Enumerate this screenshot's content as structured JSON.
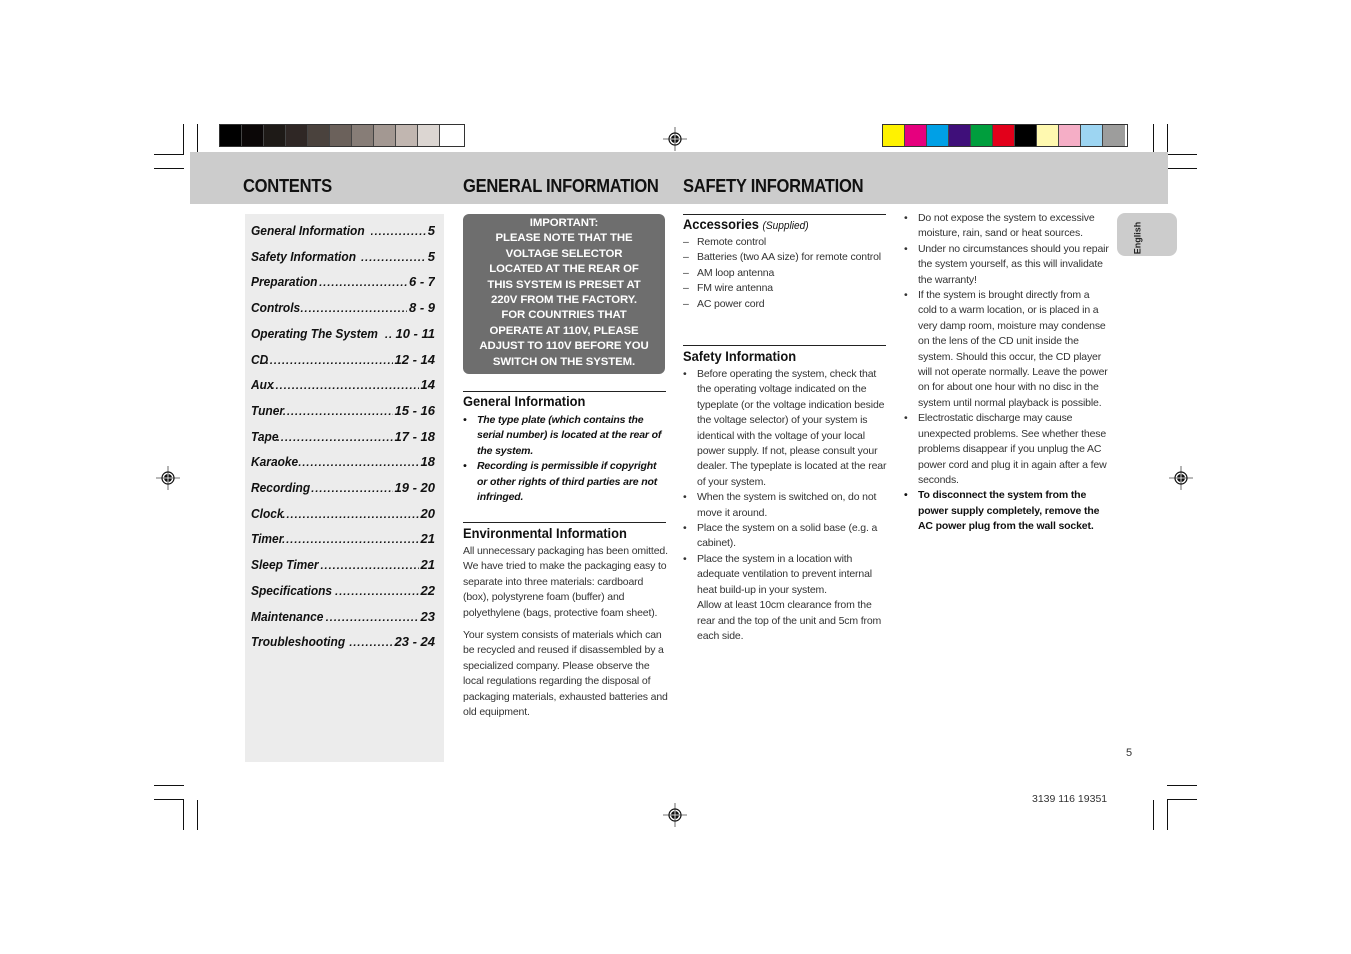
{
  "header": {
    "contents_title": "CONTENTS",
    "general_title": "GENERAL INFORMATION",
    "safety_title": "SAFETY INFORMATION"
  },
  "colorbars": {
    "grayscale": [
      "#000000",
      "#0b0707",
      "#1e1a17",
      "#2f2725",
      "#4a423d",
      "#6b615b",
      "#877d77",
      "#a39892",
      "#c1b6b0",
      "#dcd6d2",
      "#ffffff"
    ],
    "process": [
      "#fff200",
      "#e6007e",
      "#00a0e6",
      "#3f0f7a",
      "#009e3d",
      "#e2001a",
      "#000000",
      "#fff9b0",
      "#f5aec6",
      "#9dd5f2",
      "#9d9d9c"
    ]
  },
  "contents": [
    {
      "label": "General Information",
      "page": "5"
    },
    {
      "label": "Safety Information",
      "page": "5"
    },
    {
      "label": "Preparation",
      "page": "6 - 7"
    },
    {
      "label": "Controls",
      "page": "8 - 9"
    },
    {
      "label": "Operating The System",
      "page": "10 - 11"
    },
    {
      "label": "CD",
      "page": "12 - 14"
    },
    {
      "label": "Aux",
      "page": "14"
    },
    {
      "label": "Tuner",
      "page": "15 - 16"
    },
    {
      "label": "Tape",
      "page": "17 - 18"
    },
    {
      "label": "Karaoke",
      "page": "18"
    },
    {
      "label": "Recording",
      "page": "19 - 20"
    },
    {
      "label": "Clock",
      "page": "20"
    },
    {
      "label": "Timer",
      "page": "21"
    },
    {
      "label": "Sleep Timer",
      "page": "21"
    },
    {
      "label": "Specifications",
      "page": "22"
    },
    {
      "label": "Maintenance",
      "page": "23"
    },
    {
      "label": "Troubleshooting",
      "page": "23 - 24"
    }
  ],
  "important": {
    "lines": [
      "IMPORTANT:",
      "PLEASE NOTE THAT THE",
      "VOLTAGE SELECTOR",
      "LOCATED AT THE REAR OF",
      "THIS SYSTEM IS PRESET AT",
      "220V FROM THE FACTORY.",
      "FOR COUNTRIES THAT",
      "OPERATE AT 110V, PLEASE",
      "ADJUST TO 110V BEFORE YOU",
      "SWITCH ON THE SYSTEM."
    ]
  },
  "general_info": {
    "heading": "General Information",
    "bullets": [
      "The type plate (which contains the serial number) is located at the rear of the system.",
      "Recording is permissible if copyright or other rights of third parties are not infringed."
    ]
  },
  "environmental": {
    "heading": "Environmental Information",
    "paragraphs": [
      "All unnecessary packaging has been omitted. We have tried to make the packaging easy to separate into three materials: cardboard (box), polystyrene foam (buffer) and polyethylene (bags, protective foam sheet).",
      "Your system consists of materials which can be recycled and reused if disassembled by a specialized company. Please observe the local regulations regarding the disposal of packaging materials, exhausted batteries and old equipment."
    ]
  },
  "accessories": {
    "heading": "Accessories",
    "subheading": "(Supplied)",
    "items": [
      "Remote control",
      "Batteries (two AA size) for remote control",
      "AM loop antenna",
      "FM wire antenna",
      "AC power cord"
    ]
  },
  "safety": {
    "heading": "Safety Information",
    "bullets_col1": [
      "Before operating the system, check that the operating voltage indicated on the typeplate (or the voltage indication beside the voltage selector) of your system is identical with the voltage of your local power supply. If not, please consult your dealer. The typeplate is located at the rear of your system.",
      "When the system is switched on, do not move it around.",
      "Place the system on a solid base (e.g. a cabinet).",
      "Place the system in a location with adequate ventilation to prevent internal heat build-up in your system.",
      "Allow at least 10cm clearance from the rear and the top of the unit and 5cm from each side."
    ],
    "bullets_col2": [
      "Do not expose the system to excessive moisture, rain, sand or heat sources.",
      "Under no circumstances should you repair the system yourself, as this will invalidate the warranty!",
      "If the system is brought directly from a cold to a warm location, or is placed in a very damp room, moisture may condense on the lens of the CD unit inside the system. Should this occur, the CD player will not operate normally. Leave the power on for about one hour with no disc in the system until normal playback is possible.",
      "Electrostatic discharge may cause unexpected problems. See whether these problems disappear if you unplug the AC power cord and plug it in again after a few seconds.",
      "To disconnect the system from the power supply completely, remove the AC power plug from the wall socket."
    ]
  },
  "language_tab": "English",
  "page_number": "5",
  "document_number": "3139 116 19351"
}
